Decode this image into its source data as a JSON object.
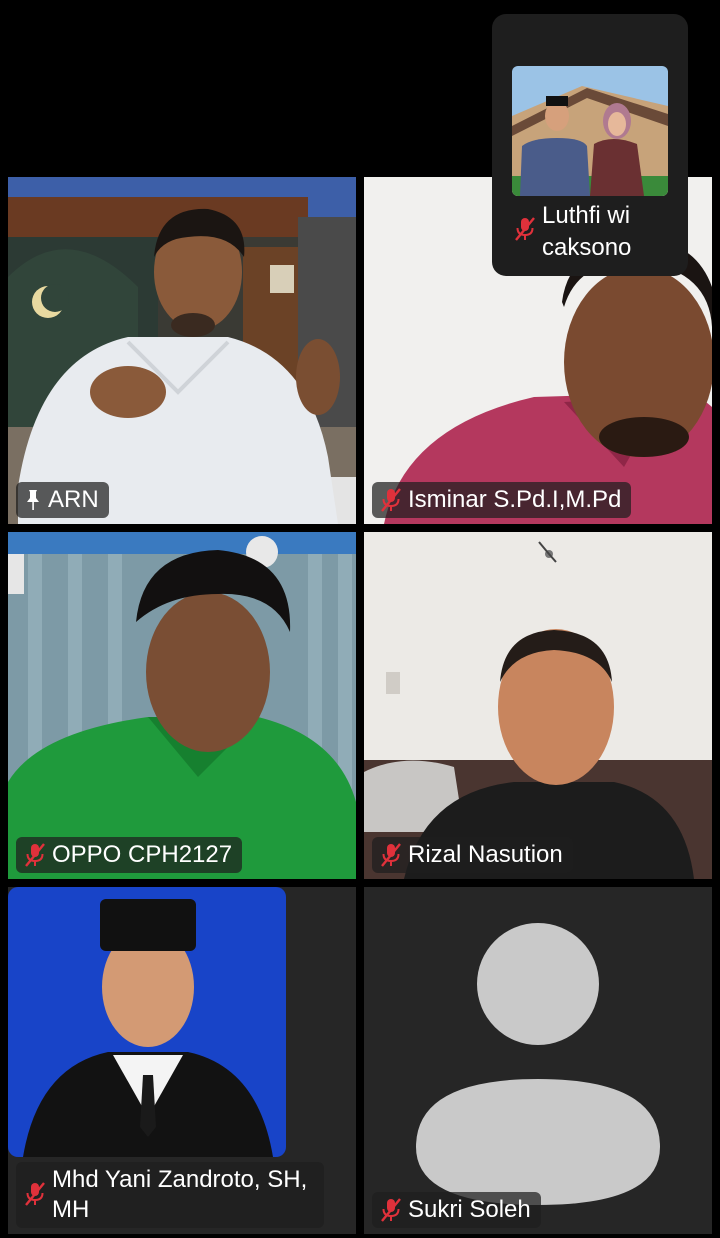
{
  "meeting": {
    "participants": [
      {
        "id": "arn",
        "name": "ARN",
        "status_icon": "pin-icon",
        "active_speaker": true
      },
      {
        "id": "isminar",
        "name": "Isminar S.Pd.I,M.Pd",
        "status_icon": "mic-muted-icon",
        "active_speaker": false
      },
      {
        "id": "oppo",
        "name": "OPPO CPH2127",
        "status_icon": "mic-muted-icon",
        "active_speaker": false
      },
      {
        "id": "rizal",
        "name": "Rizal Nasution",
        "status_icon": "mic-muted-icon",
        "active_speaker": false
      },
      {
        "id": "mhd",
        "name": "Mhd Yani Zandroto, SH, MH",
        "status_icon": "mic-muted-icon",
        "active_speaker": false
      },
      {
        "id": "sukri",
        "name": "Sukri Soleh",
        "status_icon": "mic-muted-icon",
        "active_speaker": false
      }
    ],
    "pip": {
      "name": "Luthfi wi caksono",
      "status_icon": "mic-muted-icon"
    }
  },
  "colors": {
    "active_border": "#3ac24a",
    "muted_icon": "#e0313b",
    "label_bg": "#1e1e1e",
    "background": "#000000"
  }
}
